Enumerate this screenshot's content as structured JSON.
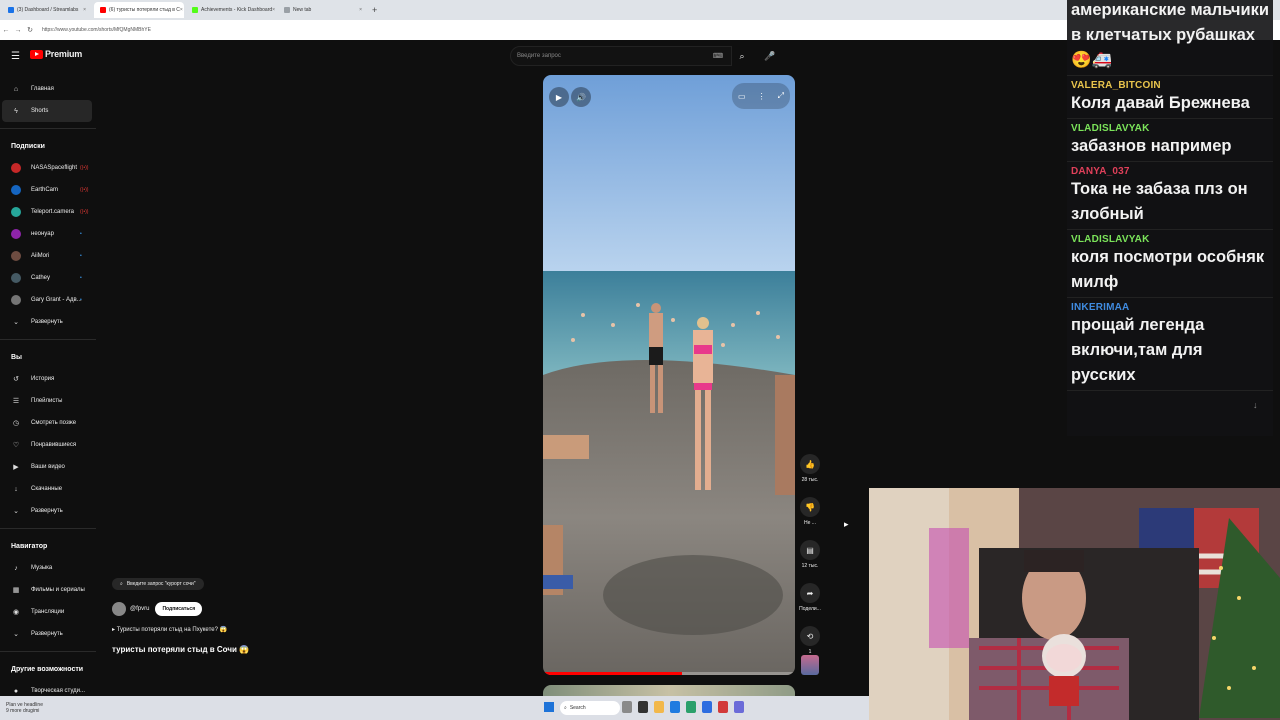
{
  "browser": {
    "tabs": [
      {
        "label": "(3) Dashboard / Streamlabs",
        "active": false,
        "color": "#1a73e8"
      },
      {
        "label": "(6) туристы потеряли стыд в С",
        "active": true,
        "color": "#ff0000"
      },
      {
        "label": "Achievements - Kick Dashboard",
        "active": false,
        "color": "#53fc18"
      },
      {
        "label": "New tab",
        "active": false,
        "color": "#9aa0a6"
      }
    ],
    "url": "https://www.youtube.com/shorts/MfQMgNMBhYE"
  },
  "youtube": {
    "logo_text": "Premium",
    "search_placeholder": "Введите запрос",
    "sidebar": {
      "main": [
        {
          "label": "Главная",
          "icon": "home-icon",
          "glyph": "⌂",
          "active": false
        },
        {
          "label": "Shorts",
          "icon": "shorts-icon",
          "glyph": "ϟ",
          "active": true
        }
      ],
      "subs_title": "Подписки",
      "subs": [
        {
          "label": "NASASpaceflight",
          "color": "#c62828",
          "dot": "((•))",
          "dotColor": "#e53935"
        },
        {
          "label": "EarthCam",
          "color": "#1565c0",
          "dot": "((•))",
          "dotColor": "#e53935"
        },
        {
          "label": "Teleport.camera",
          "color": "#26a69a",
          "dot": "((•))",
          "dotColor": "#e53935"
        },
        {
          "label": "неонуар",
          "color": "#8e24aa",
          "dot": "•",
          "dotColor": "#3ea6ff"
        },
        {
          "label": "AiiMori",
          "color": "#6d4c41",
          "dot": "•",
          "dotColor": "#3ea6ff"
        },
        {
          "label": "Cathey",
          "color": "#455a64",
          "dot": "•",
          "dotColor": "#3ea6ff"
        },
        {
          "label": "Gary Grant - Адв...",
          "color": "#757575",
          "dot": "•",
          "dotColor": "#3ea6ff"
        }
      ],
      "expand": "Развернуть",
      "you_title": "Вы",
      "you": [
        {
          "label": "История",
          "icon": "history-icon",
          "glyph": "↺"
        },
        {
          "label": "Плейлисты",
          "icon": "playlists-icon",
          "glyph": "☰"
        },
        {
          "label": "Смотреть позже",
          "icon": "watch-later-icon",
          "glyph": "◷"
        },
        {
          "label": "Понравившиеся",
          "icon": "liked-icon",
          "glyph": "♡"
        },
        {
          "label": "Ваши видео",
          "icon": "your-videos-icon",
          "glyph": "▶"
        },
        {
          "label": "Скачанные",
          "icon": "downloads-icon",
          "glyph": "↓"
        }
      ],
      "nav_title": "Навигатор",
      "nav": [
        {
          "label": "Музыка",
          "icon": "music-icon",
          "glyph": "♪"
        },
        {
          "label": "Фильмы и сериалы",
          "icon": "movies-icon",
          "glyph": "▦"
        },
        {
          "label": "Трансляции",
          "icon": "live-icon",
          "glyph": "◉"
        }
      ],
      "more_title": "Другие возможности",
      "more": [
        {
          "label": "Творческая студи...",
          "icon": "studio-icon",
          "glyph": "●"
        }
      ]
    },
    "short": {
      "search_chip": "Введите запрос \"курорт сочи\"",
      "channel": "@fpvru",
      "subscribe": "Подписаться",
      "playlist": "Туристы потеряли стыд на Пхукете? 😱",
      "title": "туристы потеряли стыд в Сочи 😱",
      "progress": 0.55,
      "actions": [
        {
          "icon": "like-icon",
          "glyph": "👍",
          "label": "28 тыс."
        },
        {
          "icon": "dislike-icon",
          "glyph": "👎",
          "label": "Не ..."
        },
        {
          "icon": "comments-icon",
          "glyph": "▤",
          "label": "12 тыс."
        },
        {
          "icon": "share-icon",
          "glyph": "➦",
          "label": "Подели..."
        },
        {
          "icon": "remix-icon",
          "glyph": "⟲",
          "label": "1"
        }
      ]
    }
  },
  "chat": {
    "messages": [
      {
        "user": "",
        "color": "#ffffff",
        "text": "американские мальчики в клетчатых рубашках 😍🚑"
      },
      {
        "user": "VALERA_BITCOIN",
        "color": "#e8c44c",
        "text": "Коля давай Брежнева"
      },
      {
        "user": "VLADISLAVYAK",
        "color": "#7be35a",
        "text": "забазнов например"
      },
      {
        "user": "DANYA_037",
        "color": "#e0405a",
        "text": "Тока не забаза плз он злобный"
      },
      {
        "user": "VLADISLAVYAK",
        "color": "#7be35a",
        "text": "коля посмотри особняк милф"
      },
      {
        "user": "INKERIMAA",
        "color": "#3f8be0",
        "text": "прощай легенда включи,там для русских"
      }
    ]
  },
  "taskbar": {
    "news_line1": "Plan ve headline",
    "news_line2": "9 more drugimi",
    "search": "Search"
  }
}
